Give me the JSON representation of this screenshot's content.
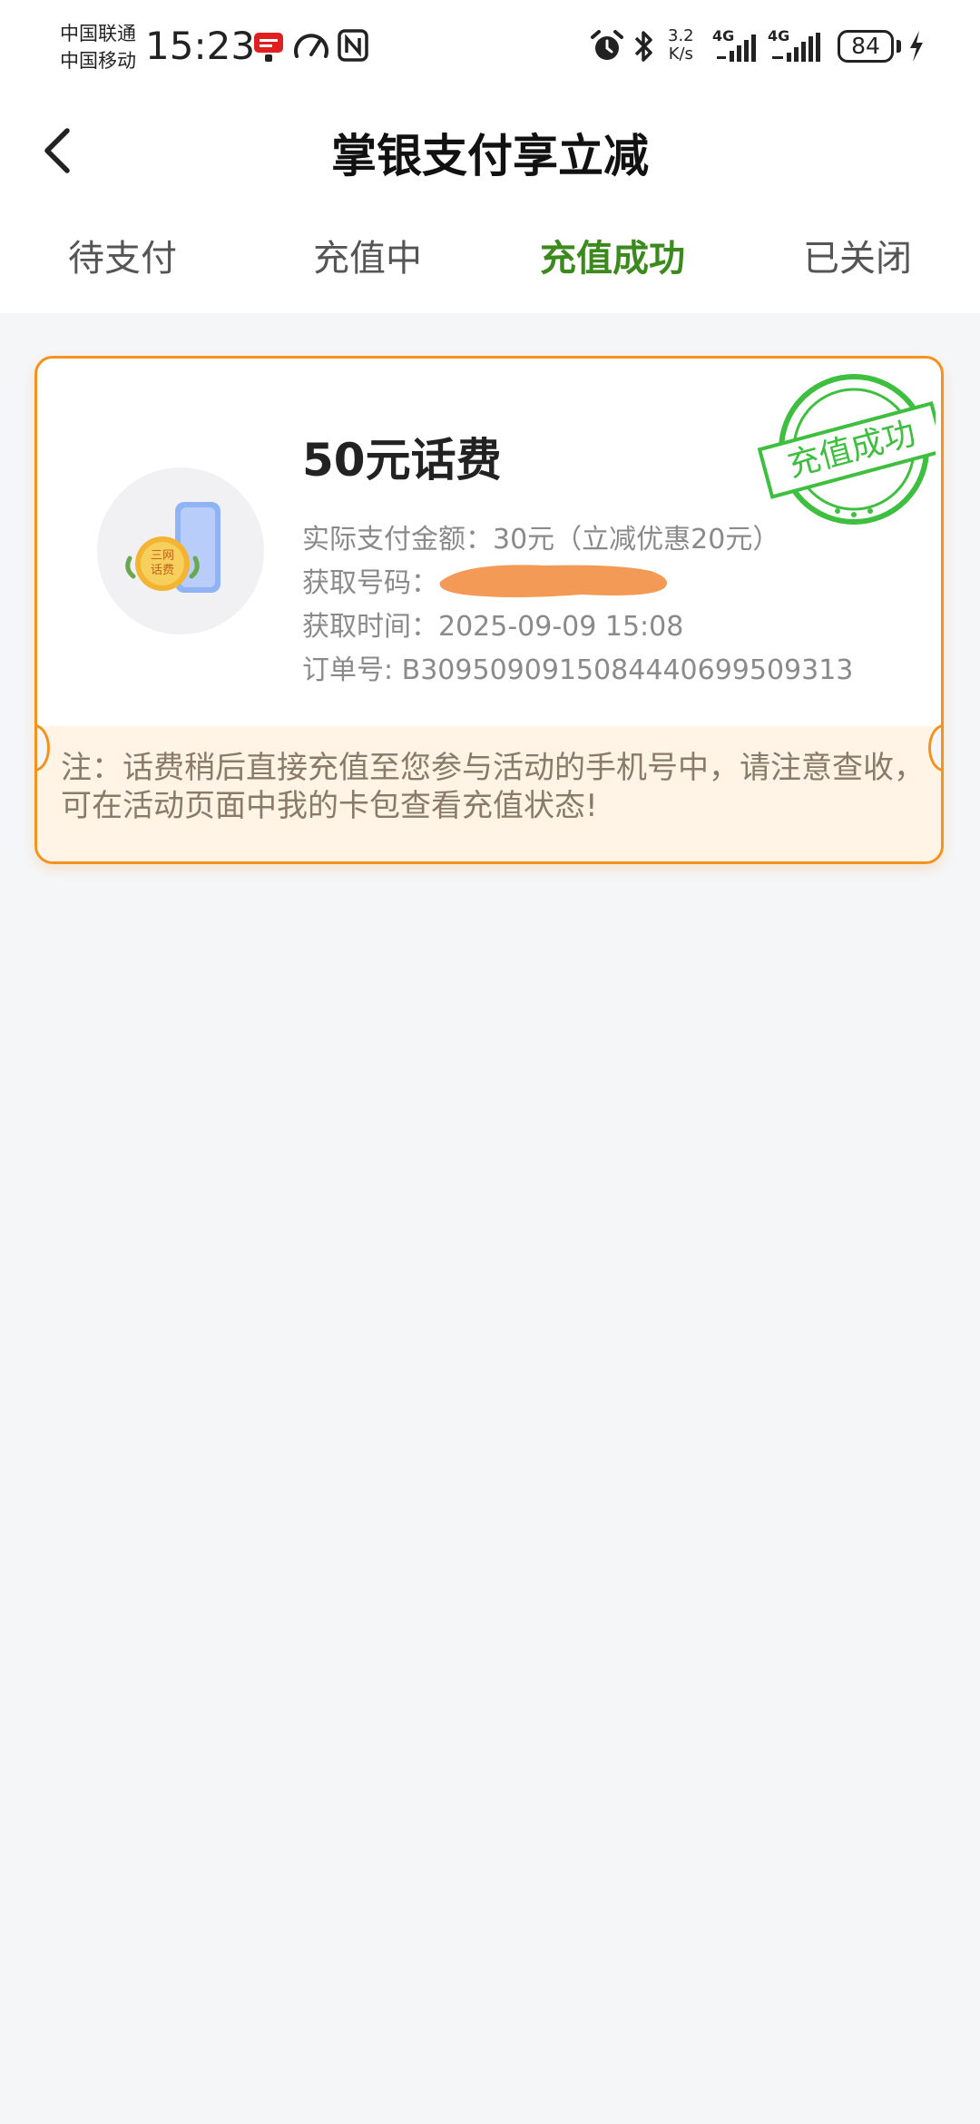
{
  "status_bar": {
    "carrier_1": "中国联通",
    "carrier_2": "中国移动",
    "time": "15:23",
    "net_speed_value": "3.2",
    "net_speed_unit": "K/s",
    "network_1": "4G",
    "network_2": "4G",
    "battery": "84",
    "icons": [
      "app-notification-icon",
      "speed-gauge-icon",
      "nfc-icon",
      "alarm-icon",
      "bluetooth-icon",
      "signal-icon",
      "charging-icon"
    ]
  },
  "header": {
    "title": "掌银支付享立减",
    "back_icon": "chevron-left-icon"
  },
  "tabs": [
    {
      "label": "待支付",
      "active": false
    },
    {
      "label": "充值中",
      "active": false
    },
    {
      "label": "充值成功",
      "active": true
    },
    {
      "label": "已关闭",
      "active": false
    }
  ],
  "colors": {
    "accent_green": "#3c8a1e",
    "card_border": "#f5921e",
    "stamp_green": "#3fbf3f",
    "redaction": "#f29a56"
  },
  "order": {
    "title": "50元话费",
    "icon_badge_line1": "三网",
    "icon_badge_line2": "话费",
    "actual_payment": "实际支付金额：30元（立减优惠20元）",
    "phone_label": "获取号码：",
    "time_line": "获取时间：2025-09-09 15:08",
    "order_number": "订单号: B3095090915084440699509313",
    "stamp_text": "充值成功",
    "note": "注：话费稍后直接充值至您参与活动的手机号中，请注意查收，可在活动页面中我的卡包查看充值状态!"
  }
}
